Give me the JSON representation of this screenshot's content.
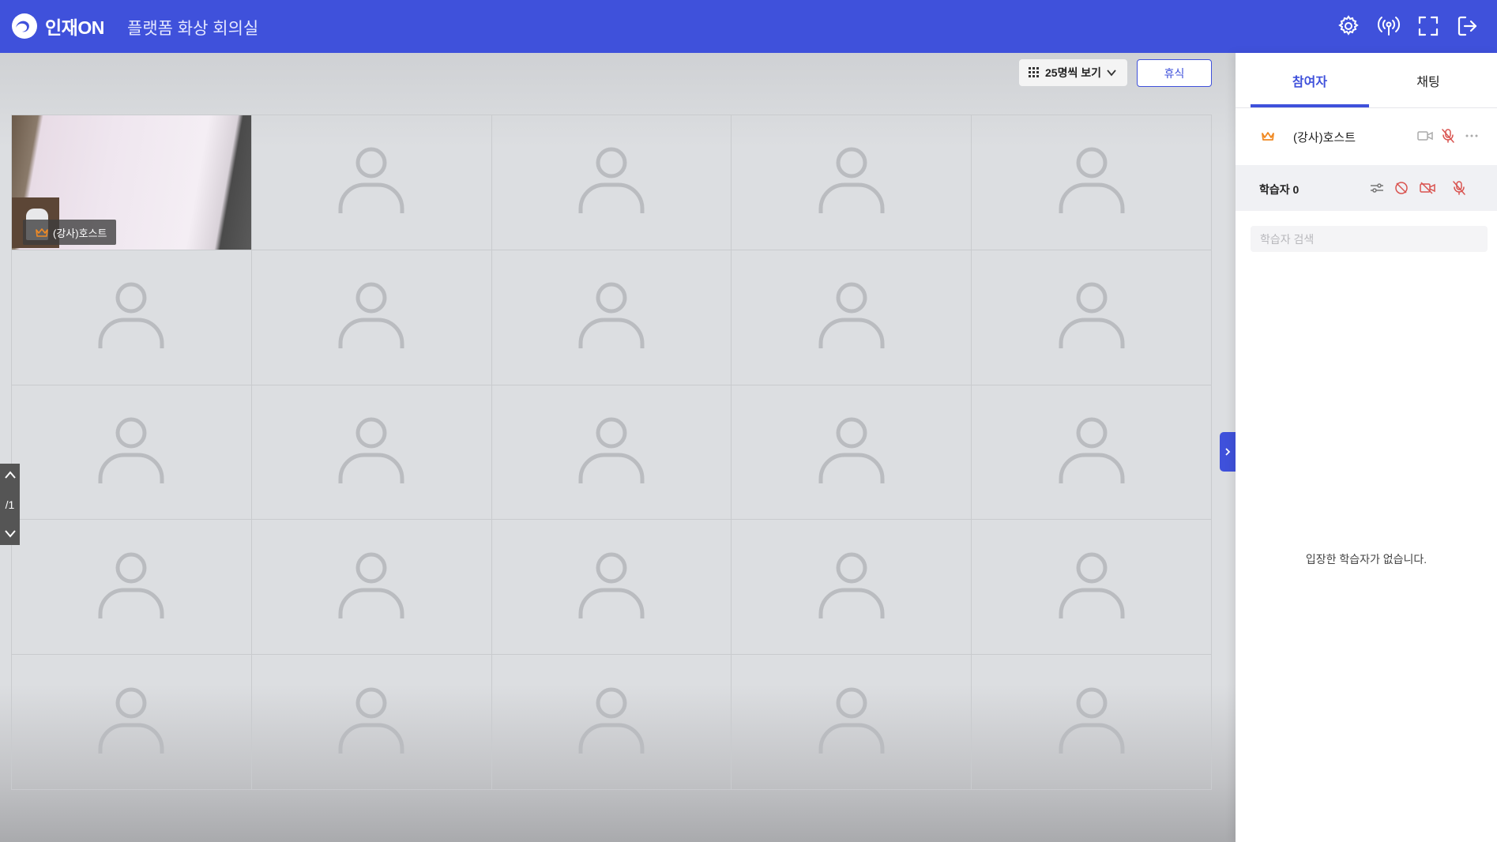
{
  "header": {
    "brand_name": "인재ON",
    "room_title": "플랫폼 화상 회의실",
    "icons": [
      "gear-icon",
      "broadcast-icon",
      "fullscreen-icon",
      "logout-icon"
    ]
  },
  "toolbar": {
    "view_label": "25명씩 보기",
    "break_label": "휴식"
  },
  "grid": {
    "columns": 5,
    "rows": 5,
    "host_tile_label": "(강사)호스트"
  },
  "pager": {
    "page_label": "/1"
  },
  "side": {
    "tabs": [
      {
        "label": "참여자",
        "active": true
      },
      {
        "label": "채팅",
        "active": false
      }
    ],
    "host_name": "(강사)호스트",
    "learner_label": "학습자",
    "learner_count": "0",
    "search_placeholder": "학습자 검색",
    "empty_message": "입장한 학습자가 없습니다."
  },
  "colors": {
    "accent": "#3f51db",
    "crown": "#f08a24",
    "muted_red": "#d9534f"
  }
}
